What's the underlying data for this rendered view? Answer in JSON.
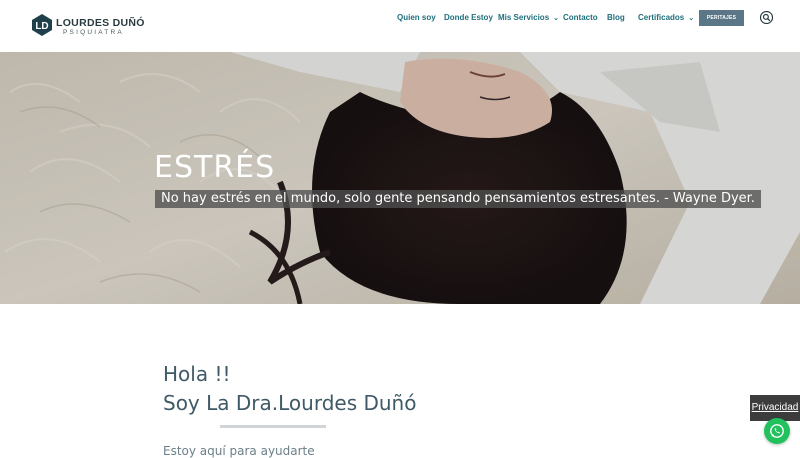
{
  "brand": {
    "initials": "LD",
    "name": "LOURDES DUÑÓ",
    "subtitle": "PSIQUIATRA",
    "color": "#1f3f4a"
  },
  "nav": {
    "items": [
      {
        "label": "Quien soy"
      },
      {
        "label": "Donde Estoy"
      },
      {
        "label": "Mis Servicios",
        "has_dropdown": true
      },
      {
        "label": "Contacto"
      },
      {
        "label": "Blog"
      },
      {
        "label": "Certificados",
        "has_dropdown": true
      }
    ],
    "cta_label": "PERITAJES",
    "search_icon": "search-icon",
    "link_color": "#1f6f7c",
    "cta_color": "#5b7686"
  },
  "hero": {
    "title": "ESTRÉS",
    "quote": "No hay estrés en el mundo, solo gente pensando pensamientos estresantes. - Wayne Dyer."
  },
  "content": {
    "greeting": "Hola !!",
    "intro": "Soy La Dra.Lourdes Duñó",
    "subtext": "Estoy aquí para ayudarte",
    "text_color": "#3f5a66"
  },
  "floating": {
    "privacy_label": "Privacidad",
    "whatsapp_icon": "whatsapp-icon",
    "whatsapp_color": "#21c25e"
  }
}
